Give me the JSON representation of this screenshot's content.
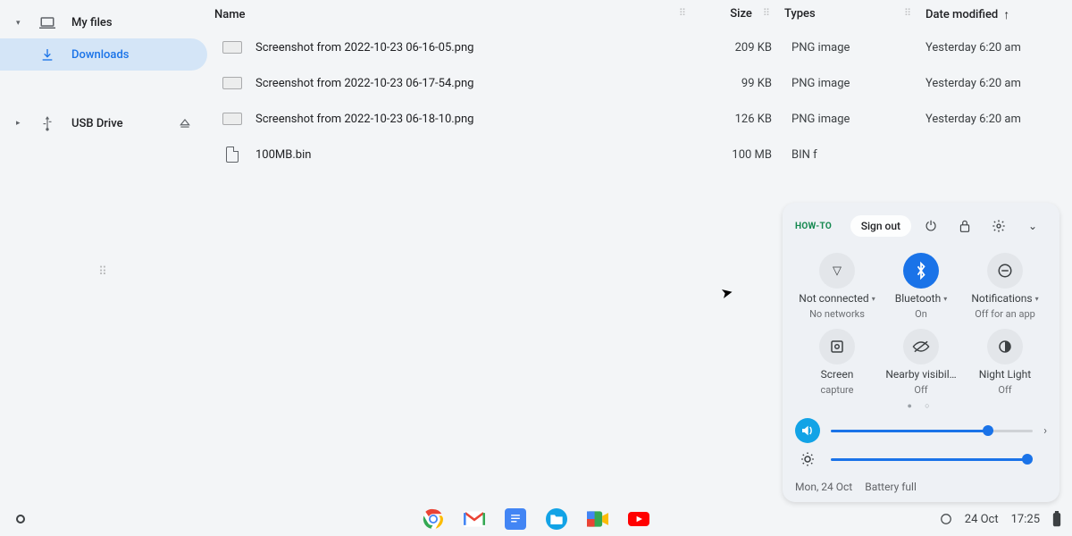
{
  "sidebar": {
    "items": [
      {
        "label": "My files"
      },
      {
        "label": "Downloads"
      },
      {
        "label": "USB Drive"
      }
    ]
  },
  "columns": {
    "name": "Name",
    "size": "Size",
    "types": "Types",
    "date": "Date modified"
  },
  "files": [
    {
      "name": "Screenshot from 2022-10-23 06-16-05.png",
      "size": "209 KB",
      "type": "PNG image",
      "date": "Yesterday 6:20 am"
    },
    {
      "name": "Screenshot from 2022-10-23 06-17-54.png",
      "size": "99 KB",
      "type": "PNG image",
      "date": "Yesterday 6:20 am"
    },
    {
      "name": "Screenshot from 2022-10-23 06-18-10.png",
      "size": "126 KB",
      "type": "PNG image",
      "date": "Yesterday 6:20 am"
    },
    {
      "name": "100MB.bin",
      "size": "100 MB",
      "type": "BIN f",
      "date": ""
    }
  ],
  "qs": {
    "howto": "HOW-TO",
    "signout": "Sign out",
    "row1": [
      {
        "label": "Not connected",
        "sub": "No networks",
        "dropdown": true
      },
      {
        "label": "Bluetooth",
        "sub": "On",
        "dropdown": true,
        "on": true
      },
      {
        "label": "Notifications",
        "sub": "Off for an app",
        "dropdown": true
      }
    ],
    "row2": [
      {
        "label": "Screen",
        "sub": "capture"
      },
      {
        "label": "Nearby visibil…",
        "sub": "Off"
      },
      {
        "label": "Night Light",
        "sub": "Off"
      }
    ],
    "vol_pct": 78,
    "bri_pct": 100,
    "footer_date": "Mon, 24 Oct",
    "footer_batt": "Battery full"
  },
  "shelf": {
    "date": "24 Oct",
    "time": "17:25"
  }
}
